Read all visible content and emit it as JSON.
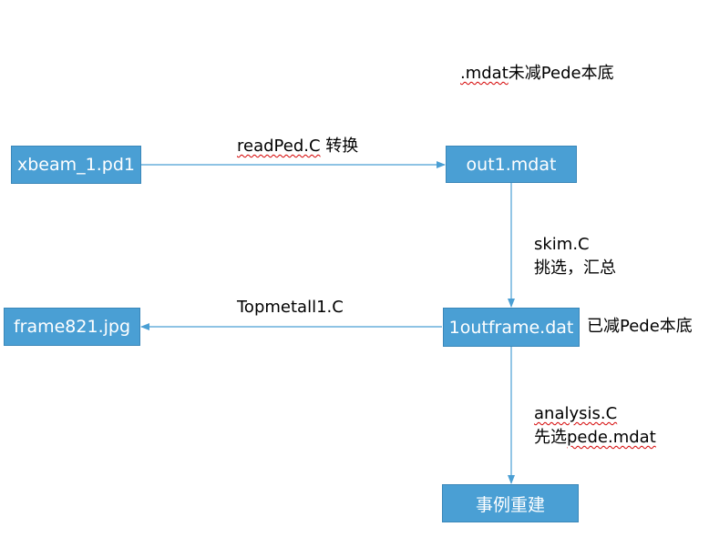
{
  "nodes": {
    "xbeam": "xbeam_1.pd1",
    "out1": "out1.mdat",
    "outframe": "1outframe.dat",
    "frame": "frame821.jpg",
    "reconstruct": "事例重建"
  },
  "notes": {
    "mdat_prefix": ".mdat",
    "mdat_suffix": "未减Pede本底",
    "subtracted": "已减Pede本底"
  },
  "edges": {
    "readped_name": "readPed.C",
    "readped_action": " 转换",
    "skim_name": "skim.C",
    "skim_action": "挑选，汇总",
    "topmetal_name": "Topmetall1.C",
    "analysis_name": "analysis.C",
    "analysis_action_prefix": "先选",
    "analysis_action_file": "pede.mdat"
  },
  "colors": {
    "box_fill": "#4a9fd4",
    "box_text": "#ffffff",
    "arrow": "#4a9fd4",
    "spellcheck_underline": "#d40000"
  }
}
